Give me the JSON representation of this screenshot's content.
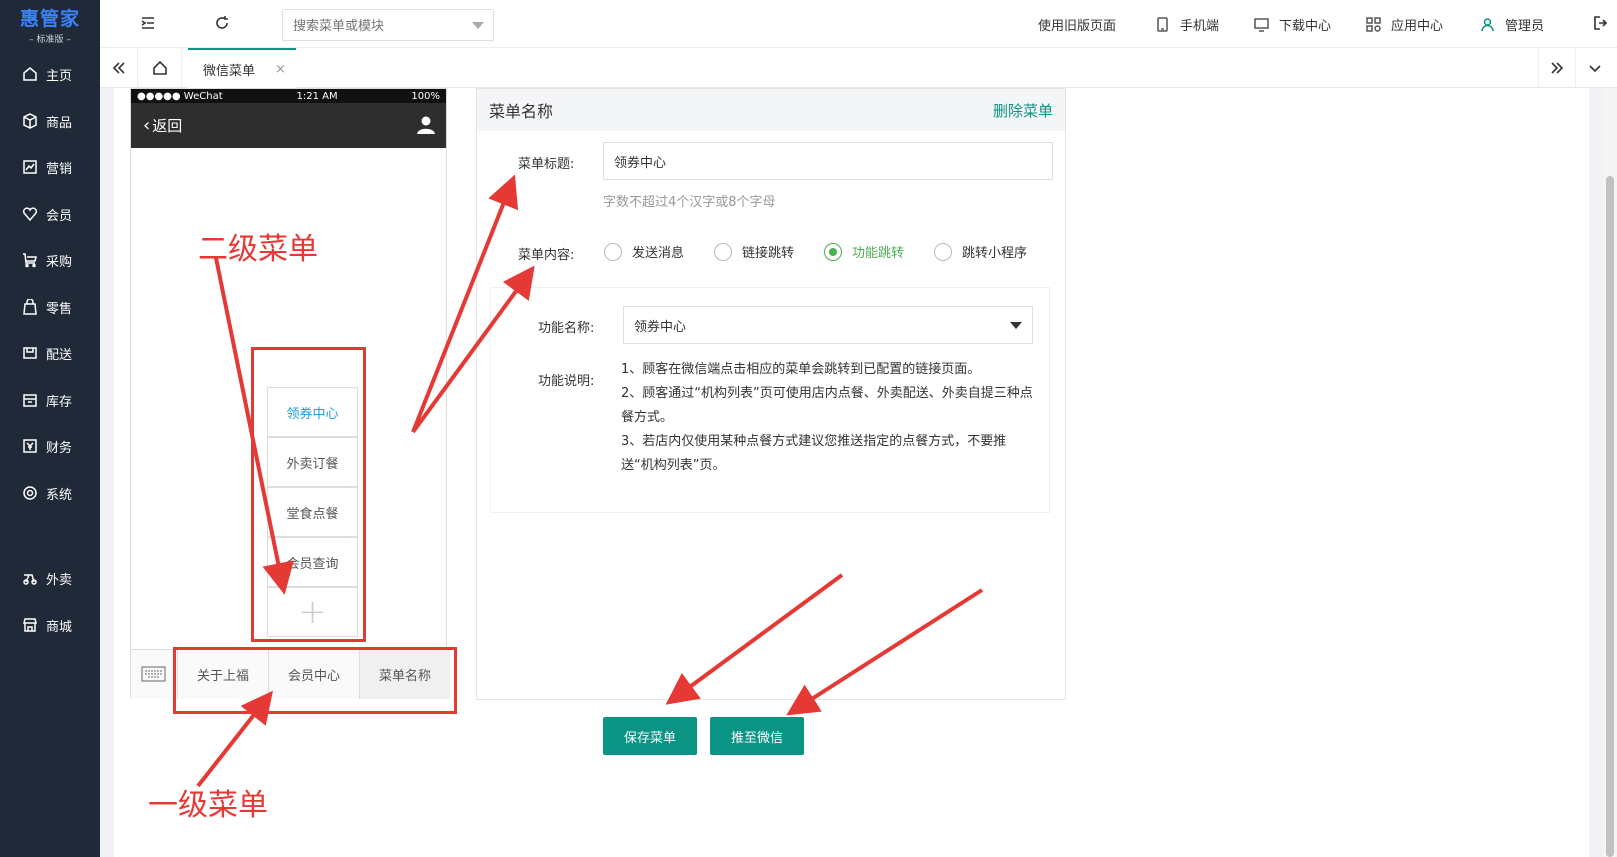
{
  "app": {
    "logo_main": "惠管家",
    "logo_sub": "– 标准版 –"
  },
  "sidebar": {
    "items": [
      {
        "label": "主页",
        "icon": "home-icon"
      },
      {
        "label": "商品",
        "icon": "box-icon"
      },
      {
        "label": "营销",
        "icon": "chart-icon"
      },
      {
        "label": "会员",
        "icon": "heart-icon"
      },
      {
        "label": "采购",
        "icon": "cart-icon"
      },
      {
        "label": "零售",
        "icon": "bag-icon"
      },
      {
        "label": "配送",
        "icon": "truck-icon"
      },
      {
        "label": "库存",
        "icon": "inventory-icon"
      },
      {
        "label": "财务",
        "icon": "yen-icon"
      },
      {
        "label": "系统",
        "icon": "settings-icon"
      },
      {
        "label": "外卖",
        "icon": "scooter-icon"
      },
      {
        "label": "商城",
        "icon": "store-icon"
      }
    ]
  },
  "topbar": {
    "search_placeholder": "搜索菜单或模块",
    "old_page": "使用旧版页面",
    "mobile": "手机端",
    "download": "下载中心",
    "apps": "应用中心",
    "user": "管理员"
  },
  "tabs": {
    "active": "微信菜单",
    "close": "×"
  },
  "phone": {
    "carrier": "●●●●● WeChat",
    "time": "1:21 AM",
    "battery": "100%",
    "back": "返回",
    "submenu": [
      "领券中心",
      "外卖订餐",
      "堂食点餐",
      "会员查询"
    ],
    "add": "+",
    "bottom_menu": [
      "关于上福",
      "会员中心",
      "菜单名称"
    ]
  },
  "form": {
    "header_title": "菜单名称",
    "delete": "删除菜单",
    "title_label": "菜单标题:",
    "title_value": "领券中心",
    "title_hint": "字数不超过4个汉字或8个字母",
    "content_label": "菜单内容:",
    "radios": [
      "发送消息",
      "链接跳转",
      "功能跳转",
      "跳转小程序"
    ],
    "selected_radio": "功能跳转",
    "func_label": "功能名称:",
    "func_value": "领券中心",
    "desc_label": "功能说明:",
    "desc": [
      "1、顾客在微信端点击相应的菜单会跳转到已配置的链接页面。",
      "2、顾客通过“机构列表”页可使用店内点餐、外卖配送、外卖自提三种点餐方式。",
      "3、若店内仅使用某种点餐方式建议您推送指定的点餐方式，不要推送“机构列表”页。"
    ],
    "save": "保存菜单",
    "push": "推至微信"
  },
  "annotations": {
    "level2": "二级菜单",
    "level1": "一级菜单"
  },
  "colors": {
    "accent": "#0a9484",
    "sidebar": "#1f2937",
    "annotation": "#e53935",
    "radio_checked": "#4caf50",
    "submenu_active": "#1e9be0"
  }
}
